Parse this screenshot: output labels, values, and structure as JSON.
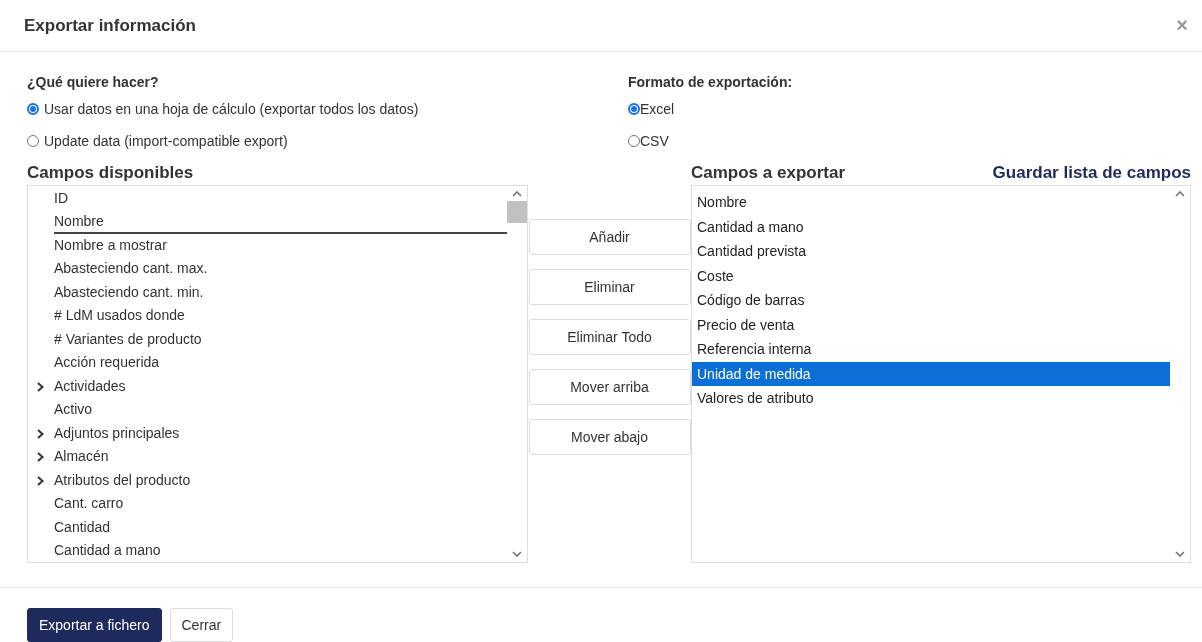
{
  "dialog": {
    "title": "Exportar información",
    "close": "×"
  },
  "action": {
    "label": "¿Qué quiere hacer?",
    "options": [
      {
        "label": "Usar datos en una hoja de cálculo (exportar todos los datos)",
        "selected": true
      },
      {
        "label": "Update data (import-compatible export)",
        "selected": false
      }
    ]
  },
  "format": {
    "label": "Formato de exportación:",
    "options": [
      {
        "label": "Excel",
        "selected": true
      },
      {
        "label": "CSV",
        "selected": false
      }
    ]
  },
  "available": {
    "title": "Campos disponibles",
    "items": [
      {
        "label": "ID",
        "kind": "field",
        "selected": false
      },
      {
        "label": "Nombre",
        "kind": "field",
        "selected": true
      },
      {
        "label": "Nombre a mostrar",
        "kind": "field",
        "selected": false
      },
      {
        "label": "Abasteciendo cant. max.",
        "kind": "field",
        "selected": false
      },
      {
        "label": "Abasteciendo cant. min.",
        "kind": "field",
        "selected": false
      },
      {
        "label": "# LdM usados donde",
        "kind": "field",
        "selected": false
      },
      {
        "label": "# Variantes de producto",
        "kind": "field",
        "selected": false
      },
      {
        "label": "Acción requerida",
        "kind": "field",
        "selected": false
      },
      {
        "label": "Actividades",
        "kind": "group",
        "selected": false
      },
      {
        "label": "Activo",
        "kind": "field",
        "selected": false
      },
      {
        "label": "Adjuntos principales",
        "kind": "group",
        "selected": false
      },
      {
        "label": "Almacén",
        "kind": "group",
        "selected": false
      },
      {
        "label": "Atributos del producto",
        "kind": "group",
        "selected": false
      },
      {
        "label": "Cant. carro",
        "kind": "field",
        "selected": false
      },
      {
        "label": "Cantidad",
        "kind": "field",
        "selected": false
      },
      {
        "label": "Cantidad a mano",
        "kind": "field",
        "selected": false
      }
    ]
  },
  "actions": [
    "Añadir",
    "Eliminar",
    "Eliminar Todo",
    "Mover arriba",
    "Mover abajo"
  ],
  "export": {
    "title": "Campos a exportar",
    "save_link": "Guardar lista de campos",
    "items": [
      {
        "label": "Nombre",
        "selected": false
      },
      {
        "label": "Cantidad a mano",
        "selected": false
      },
      {
        "label": "Cantidad prevista",
        "selected": false
      },
      {
        "label": "Coste",
        "selected": false
      },
      {
        "label": "Código de barras",
        "selected": false
      },
      {
        "label": "Precio de venta",
        "selected": false
      },
      {
        "label": "Referencia interna",
        "selected": false
      },
      {
        "label": "Unidad de medida",
        "selected": true
      },
      {
        "label": "Valores de atributo",
        "selected": false
      }
    ]
  },
  "footer": {
    "primary": "Exportar a fichero",
    "secondary": "Cerrar"
  }
}
